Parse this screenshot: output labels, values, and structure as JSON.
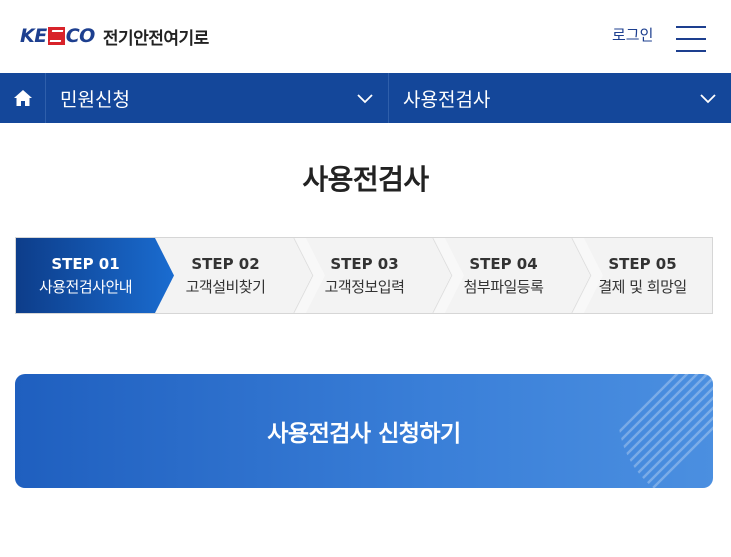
{
  "header": {
    "logo_mark": "KESCO",
    "logo_mark_left": "KE",
    "logo_mark_right": "CO",
    "logo_text": "전기안전여기로",
    "login_label": "로그인",
    "menu_icon": "hamburger-menu-icon"
  },
  "nav": {
    "home_icon": "home-icon",
    "dropdowns": [
      {
        "label": "민원신청",
        "icon": "chevron-down-icon"
      },
      {
        "label": "사용전검사",
        "icon": "chevron-down-icon"
      }
    ]
  },
  "page": {
    "title": "사용전검사"
  },
  "steps": [
    {
      "number": "STEP 01",
      "label": "사용전검사안내",
      "active": true
    },
    {
      "number": "STEP 02",
      "label": "고객설비찾기",
      "active": false
    },
    {
      "number": "STEP 03",
      "label": "고객정보입력",
      "active": false
    },
    {
      "number": "STEP 04",
      "label": "첨부파일등록",
      "active": false
    },
    {
      "number": "STEP 05",
      "label": "결제 및 희망일",
      "active": false
    }
  ],
  "cta": {
    "label": "사용전검사 신청하기"
  },
  "colors": {
    "brand_blue": "#14479a",
    "active_step_start": "#0d3d8a",
    "active_step_end": "#1a6cd0",
    "logo_red": "#d8232a",
    "cta_start": "#1f5fbf",
    "cta_end": "#4b8fe0"
  }
}
